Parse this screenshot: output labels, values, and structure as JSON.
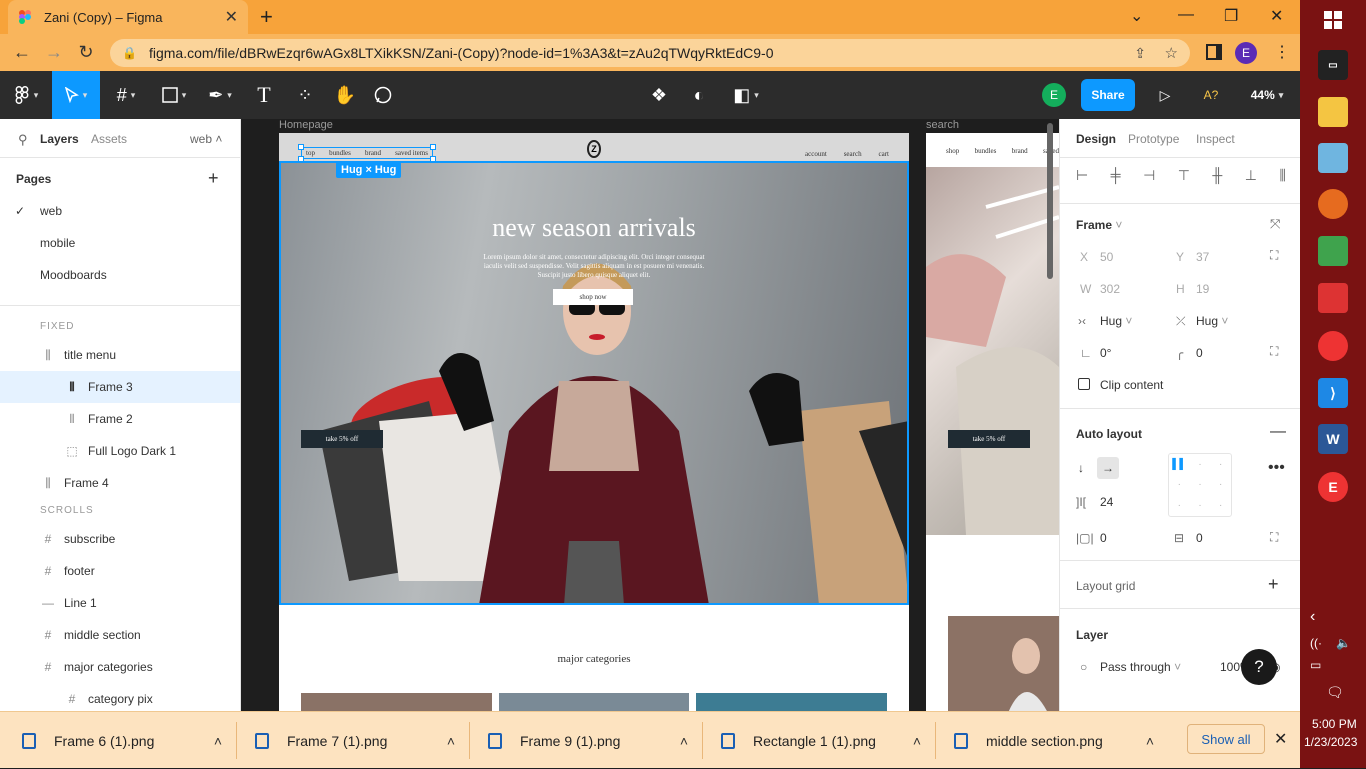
{
  "browser": {
    "tab_title": "Zani (Copy) – Figma",
    "tab_close": "✕",
    "new_tab": "+",
    "url": "figma.com/file/dBRwEzqr6wAGx8LTXikKSN/Zani-(Copy)?node-id=1%3A3&t=zAu2qTWqyRktEdC9-0",
    "profile_initial": "E"
  },
  "figma_toolbar": {
    "zoom": "44%",
    "share_label": "Share",
    "user_initial": "E",
    "font_warning": "A?"
  },
  "left_panel": {
    "tabs": {
      "layers": "Layers",
      "assets": "Assets",
      "page_selector": "web"
    },
    "pages_title": "Pages",
    "pages": [
      {
        "name": "web",
        "selected": true
      },
      {
        "name": "mobile",
        "selected": false
      },
      {
        "name": "Moodboards",
        "selected": false
      }
    ],
    "sections": {
      "fixed": "FIXED",
      "scrolls": "SCROLLS"
    },
    "layers_fixed": [
      {
        "name": "title menu",
        "icon": "autolayout-vertical-icon",
        "indent": 0
      },
      {
        "name": "Frame 3",
        "icon": "autolayout-horizontal-icon",
        "indent": 1,
        "selected": true
      },
      {
        "name": "Frame 2",
        "icon": "autolayout-horizontal-icon",
        "indent": 1
      },
      {
        "name": "Full Logo Dark 1",
        "icon": "image-frame-icon",
        "indent": 1
      },
      {
        "name": "Frame 4",
        "icon": "autolayout-vertical-icon",
        "indent": 0
      }
    ],
    "layers_scrolls": [
      {
        "name": "subscribe",
        "icon": "frame-icon",
        "indent": 0
      },
      {
        "name": "footer",
        "icon": "frame-icon",
        "indent": 0
      },
      {
        "name": "Line 1",
        "icon": "line-icon",
        "indent": 0
      },
      {
        "name": "middle section",
        "icon": "frame-icon",
        "indent": 0
      },
      {
        "name": "major categories",
        "icon": "frame-icon",
        "indent": 0
      },
      {
        "name": "category pix",
        "icon": "frame-icon",
        "indent": 1
      }
    ]
  },
  "canvas": {
    "frame1_label": "Homepage",
    "frame2_label": "search",
    "nav_left": [
      "top",
      "bundles",
      "brand",
      "saved items"
    ],
    "nav_right": [
      "account",
      "search",
      "cart"
    ],
    "logo_letter": "Z",
    "hug_badge": "Hug × Hug",
    "hero_title": "new season arrivals",
    "hero_text": "Lorem ipsum dolor sit amet, consectetur adipiscing elit. Orci integer consequat iaculis velit sed suspendisse. Velit sagittis aliquam in est posuere mi venenatis. Suscipit justo libero quisque aliquet elit.",
    "shop_now": "shop now",
    "take_off": "take 5% off",
    "major_categories": "major categories",
    "frame2_nav": [
      "shop",
      "bundles",
      "brand",
      "saved"
    ],
    "frame2_take_off": "take 5% off"
  },
  "right_panel": {
    "tabs": [
      "Design",
      "Prototype",
      "Inspect"
    ],
    "frame_label": "Frame",
    "x_label": "X",
    "x_value": "50",
    "y_label": "Y",
    "y_value": "37",
    "w_label": "W",
    "w_value": "302",
    "h_label": "H",
    "h_value": "19",
    "width_mode": "Hug",
    "height_mode": "Hug",
    "rotation": "0°",
    "radius": "0",
    "clip_content": "Clip content",
    "auto_layout_title": "Auto layout",
    "spacing": "24",
    "padding_h": "0",
    "padding_v": "0",
    "layout_grid": "Layout grid",
    "layer_title": "Layer",
    "blend_mode": "Pass through",
    "opacity": "100%",
    "help": "?"
  },
  "downloads": {
    "items": [
      "Frame 6 (1).png",
      "Frame 7 (1).png",
      "Frame 9 (1).png",
      "Rectangle 1 (1).png",
      "middle section.png"
    ],
    "show_all": "Show all"
  },
  "taskbar": {
    "time": "5:00 PM",
    "date": "1/23/2023"
  },
  "colors": {
    "chrome_tab_bg": "#f7a33a",
    "figma_blue": "#0d99ff",
    "figma_dark": "#2c2c2c",
    "share_blue": "#0d99ff",
    "avatar_green": "#14ae5c",
    "taskbar": "#7a1212"
  }
}
